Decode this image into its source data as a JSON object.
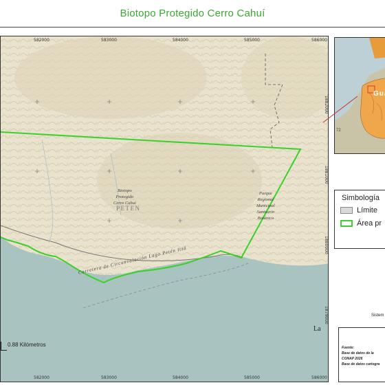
{
  "title": "Biotopo Protegido Cerro Cahuí",
  "x_ticks": [
    "582000",
    "583000",
    "584000",
    "585000",
    "586000"
  ],
  "y_ticks": [
    "1882000",
    "1881000",
    "1880000",
    "1879000"
  ],
  "map_labels": {
    "biotopo": [
      "Biotopo",
      "Protegido",
      "Cerro Cahuí"
    ],
    "peten": "PETEN",
    "parque": [
      "Parque",
      "Regional",
      "Municipal",
      "Santuario",
      "Botánico"
    ],
    "road": "Carretera de Circunvalación Lago Petén Itzá",
    "la": "La"
  },
  "inset": {
    "label": "Guate",
    "road_number": "72"
  },
  "legend": {
    "title": "Simbología",
    "items": [
      {
        "label": "Límite",
        "color": "#d9d9d9",
        "border": "#888888"
      },
      {
        "label": "Área pr",
        "color": "#ffffff",
        "border": "#39d12a"
      }
    ]
  },
  "scale_label": "0.88 Kilómetros",
  "notes": {
    "sistema": "Sistem",
    "fuente": "Fuente:",
    "line1": "Base de datos de la",
    "line2": "CONAP 2026",
    "line3": "Base de datos cartogra"
  },
  "colors": {
    "title": "#3aa832",
    "boundary": "#39d12a",
    "land": "#e9e2cc",
    "water": "#a9c4c0",
    "inset_region": "#f0a64a"
  }
}
